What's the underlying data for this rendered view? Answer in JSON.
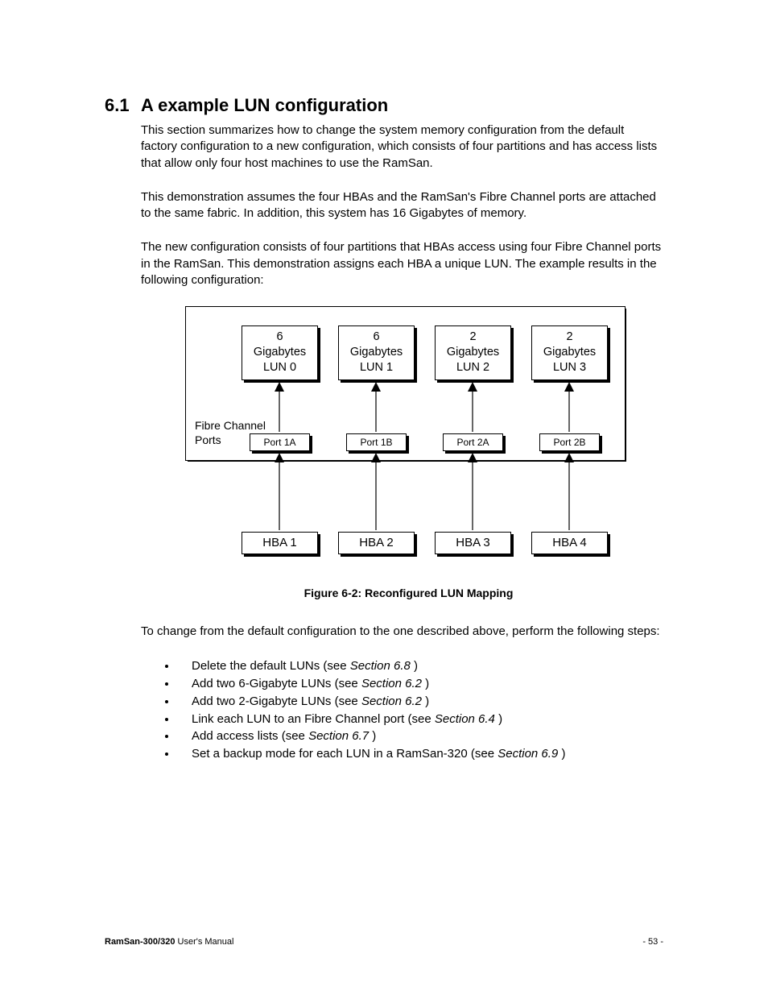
{
  "heading": {
    "number": "6.1",
    "title": "A example LUN configuration"
  },
  "paragraphs": {
    "p1": "This section summarizes how to change the system memory configuration from the default factory configuration to a new configuration, which consists of four partitions and has access lists that allow only four host machines to use the RamSan.",
    "p2": "This demonstration assumes the four HBAs and the RamSan's Fibre Channel ports are attached to the same fabric.  In addition, this system has 16 Gigabytes of memory.",
    "p3": "The new configuration consists of four partitions that HBAs access using four Fibre Channel ports in the RamSan.  This demonstration assigns each HBA a unique LUN.  The example results in the following configuration:"
  },
  "diagram": {
    "fc_label_line1": "Fibre Channel",
    "fc_label_line2": "Ports",
    "luns": [
      {
        "size": "6",
        "unit": "Gigabytes",
        "name": "LUN 0"
      },
      {
        "size": "6",
        "unit": "Gigabytes",
        "name": "LUN 1"
      },
      {
        "size": "2",
        "unit": "Gigabytes",
        "name": "LUN 2"
      },
      {
        "size": "2",
        "unit": "Gigabytes",
        "name": "LUN 3"
      }
    ],
    "ports": [
      "Port 1A",
      "Port 1B",
      "Port 2A",
      "Port 2B"
    ],
    "hbas": [
      "HBA 1",
      "HBA 2",
      "HBA 3",
      "HBA 4"
    ]
  },
  "figure_caption": "Figure 6-2: Reconfigured LUN Mapping",
  "after_fig": "To change from the default configuration to the one described above, perform the following steps:",
  "steps": [
    {
      "text": "Delete the default LUNs (see ",
      "ref": "Section 6.8",
      "tail": " )"
    },
    {
      "text": "Add two 6-Gigabyte LUNs (see ",
      "ref": "Section 6.2",
      "tail": " )"
    },
    {
      "text": "Add two 2-Gigabyte LUNs (see ",
      "ref": "Section 6.2",
      "tail": " )"
    },
    {
      "text": "Link each LUN to an Fibre Channel port (see ",
      "ref": "Section 6.4",
      "tail": " )"
    },
    {
      "text": "Add access lists (see ",
      "ref": "Section 6.7",
      "tail": " )"
    },
    {
      "text": "Set a backup mode for each LUN in a RamSan-320 (see ",
      "ref": "Section 6.9",
      "tail": " )"
    }
  ],
  "footer": {
    "product": "RamSan-300/320",
    "rest": " User's Manual",
    "page": "- 53 -"
  }
}
